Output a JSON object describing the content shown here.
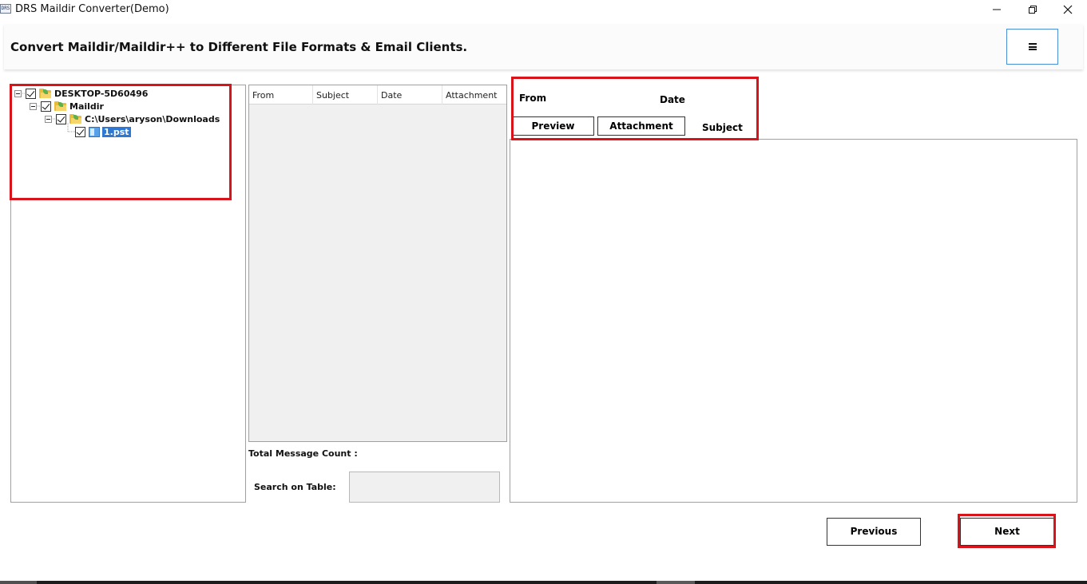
{
  "window": {
    "title": "DRS Maildir Converter(Demo)",
    "app_icon_text": "DRS",
    "controls": [
      "minimize-icon",
      "restore-icon",
      "close-icon"
    ]
  },
  "header": {
    "title": "Convert Maildir/Maildir++ to Different File Formats & Email Clients.",
    "menu_icon": "hamburger-menu-icon"
  },
  "tree": {
    "nodes": [
      {
        "label": "DESKTOP-5D60496",
        "icon": "computer-folder-icon",
        "checked": true
      },
      {
        "label": "Maildir",
        "icon": "folder-icon",
        "checked": true
      },
      {
        "label": "C:\\Users\\aryson\\Downloads",
        "icon": "folder-icon",
        "checked": true
      },
      {
        "label": "1.pst",
        "icon": "pst-file-icon",
        "checked": true,
        "selected": true
      }
    ]
  },
  "message_table": {
    "columns": [
      "From",
      "Subject",
      "Date",
      "Attachment"
    ],
    "rows": []
  },
  "total_count_label": "Total Message Count :",
  "search": {
    "label": "Search on Table:",
    "value": "",
    "placeholder": ""
  },
  "preview": {
    "from_label": "From",
    "date_label": "Date",
    "subject_label": "Subject",
    "tabs": [
      "Preview",
      "Attachment"
    ]
  },
  "navigation": {
    "previous": "Previous",
    "next": "Next"
  },
  "colors": {
    "highlight": "#d9131a",
    "menu_button_border": "#4b8ed6",
    "selection": "#2f77d0"
  }
}
